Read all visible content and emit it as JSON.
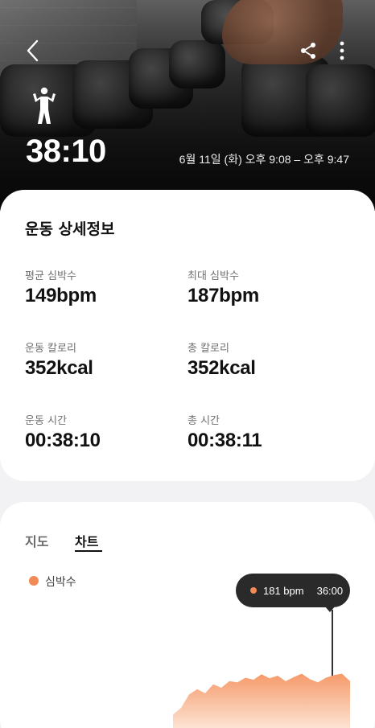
{
  "header": {
    "duration": "38:10",
    "datetime": "6월 11일 (화) 오후 9:08 – 오후 9:47",
    "icons": [
      "back-chevron-icon",
      "share-icon",
      "more-vertical-icon",
      "person-exercise-icon"
    ]
  },
  "details": {
    "title": "운동 상세정보",
    "metrics": [
      {
        "label": "평균 심박수",
        "value": "149bpm"
      },
      {
        "label": "최대 심박수",
        "value": "187bpm"
      },
      {
        "label": "운동 칼로리",
        "value": "352kcal"
      },
      {
        "label": "총 칼로리",
        "value": "352kcal"
      },
      {
        "label": "운동 시간",
        "value": "00:38:10"
      },
      {
        "label": "총 시간",
        "value": "00:38:11"
      }
    ]
  },
  "tabs": [
    {
      "label": "지도",
      "active": false
    },
    {
      "label": "차트",
      "active": true
    }
  ],
  "chart": {
    "legend": "심박수",
    "tooltip": {
      "value": "181 bpm",
      "time": "36:00"
    },
    "colors": {
      "accent": "#f28a55",
      "fill_top": "#f59a6a",
      "fill_bottom": "#fde3d3"
    },
    "chart_data": {
      "type": "area",
      "series": [
        {
          "name": "심박수",
          "values": [
            120,
            130,
            150,
            158,
            152,
            165,
            160,
            170,
            168,
            175,
            172,
            180,
            174,
            178,
            170,
            176,
            181,
            173,
            168,
            175,
            179,
            181,
            170
          ]
        }
      ]
    }
  }
}
